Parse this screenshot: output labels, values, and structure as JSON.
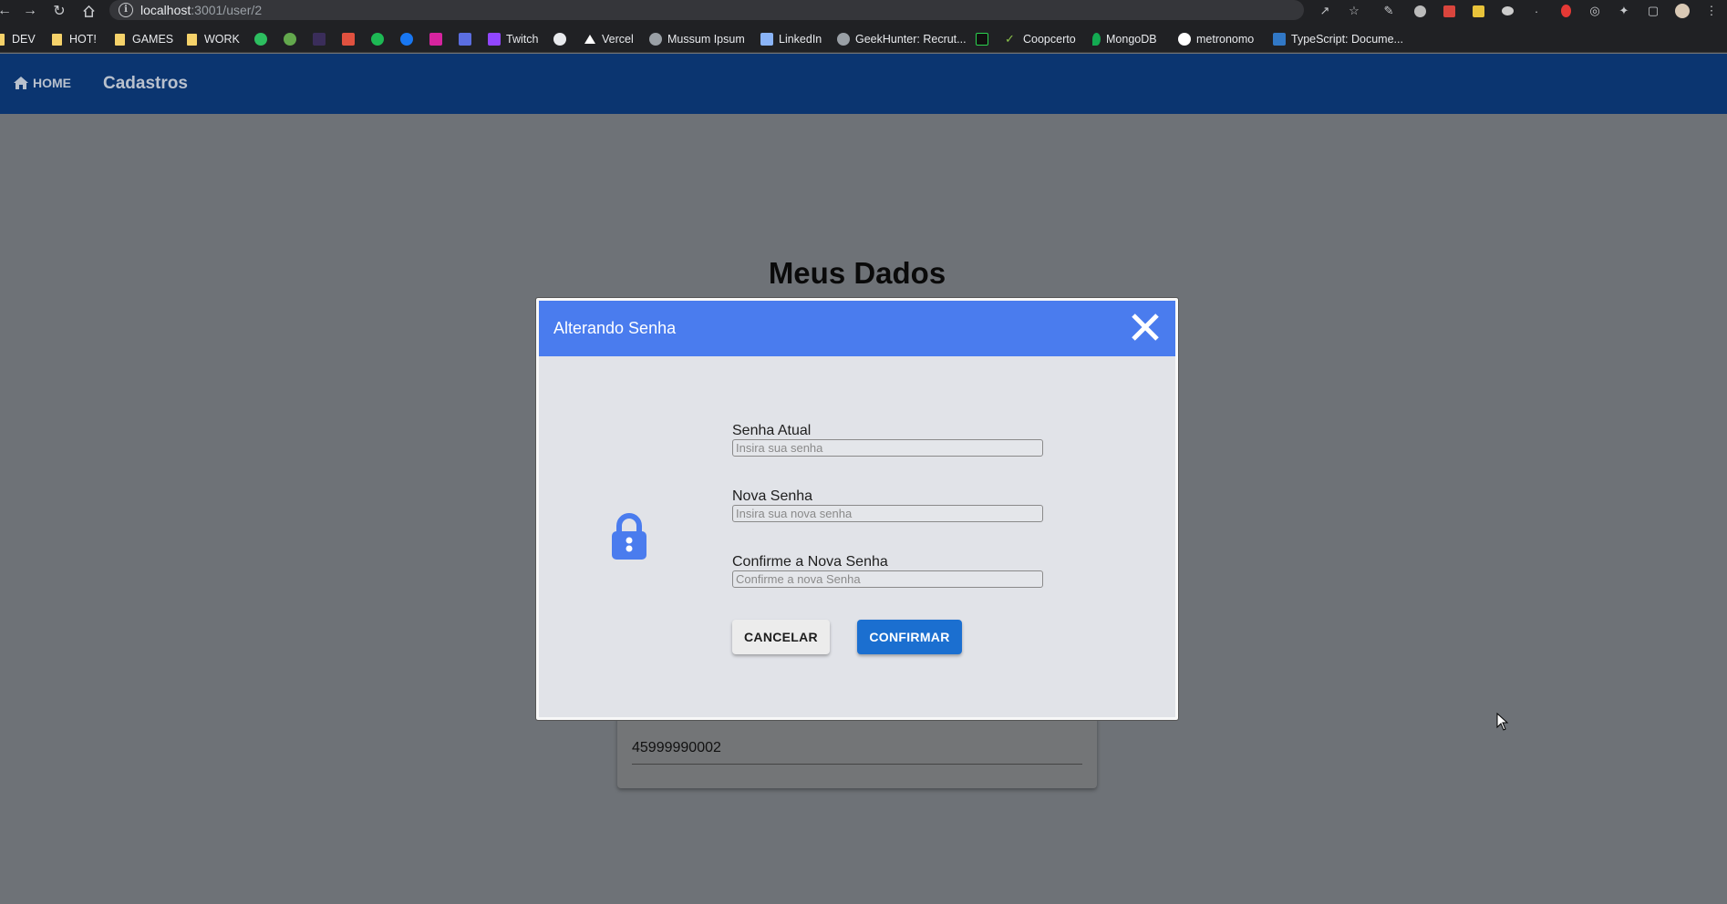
{
  "browser": {
    "url_host": "localhost",
    "url_rest": ":3001/user/2",
    "bookmarks": [
      {
        "label": "DEV",
        "type": "folder"
      },
      {
        "label": "HOT!",
        "type": "folder"
      },
      {
        "label": "GAMES",
        "type": "folder"
      },
      {
        "label": "WORK",
        "type": "folder"
      },
      {
        "label": "Twitch",
        "type": "link",
        "icon": "twitch-icon",
        "color": "#9146ff"
      },
      {
        "label": "Vercel",
        "type": "link",
        "icon": "vercel-icon",
        "color": "#ffffff"
      },
      {
        "label": "Mussum Ipsum",
        "type": "link",
        "icon": "mussum-icon",
        "color": "#9aa0a6"
      },
      {
        "label": "LinkedIn",
        "type": "link",
        "icon": "linkedin-icon",
        "color": "#8ab4f8"
      },
      {
        "label": "GeekHunter: Recrut...",
        "type": "link",
        "icon": "geekhunter-icon",
        "color": "#9aa0a6"
      },
      {
        "label": "Coopcerto",
        "type": "link",
        "icon": "coopcerto-icon",
        "color": "#9aa0a6"
      },
      {
        "label": "MongoDB",
        "type": "link",
        "icon": "mongodb-icon",
        "color": "#13aa52"
      },
      {
        "label": "metronomo",
        "type": "link",
        "icon": "google-icon",
        "color": "#ffffff"
      },
      {
        "label": "TypeScript: Docume...",
        "type": "link",
        "icon": "typescript-icon",
        "color": "#3178c6"
      }
    ]
  },
  "app": {
    "nav_home": "HOME",
    "nav_cadastros": "Cadastros",
    "colors": {
      "header": "#0b3570",
      "modal_header": "#4a7cee",
      "primary": "#1b6fd0"
    }
  },
  "page": {
    "title": "Meus Dados",
    "phone_value": "45999990002"
  },
  "modal": {
    "title": "Alterando Senha",
    "lock_icon": "lock-icon",
    "fields": [
      {
        "label": "Senha Atual",
        "placeholder": "Insira sua senha",
        "value": ""
      },
      {
        "label": "Nova Senha",
        "placeholder": "Insira sua nova senha",
        "value": ""
      },
      {
        "label": "Confirme a Nova Senha",
        "placeholder": "Confirme a nova Senha",
        "value": ""
      }
    ],
    "cancel_label": "CANCELAR",
    "confirm_label": "CONFIRMAR"
  }
}
